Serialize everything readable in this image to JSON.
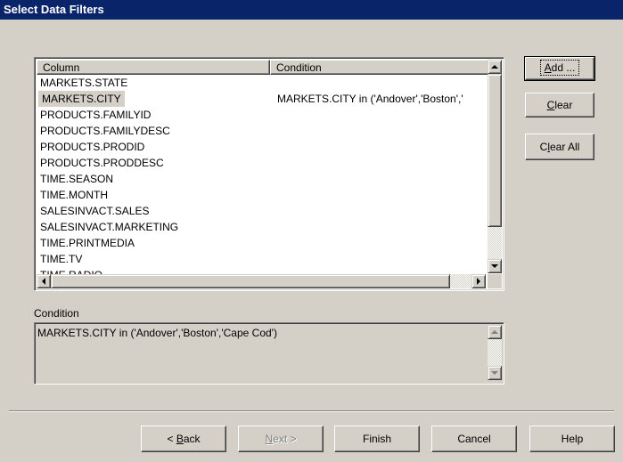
{
  "window": {
    "title": "Select Data Filters"
  },
  "list": {
    "columns": [
      "Column",
      "Condition"
    ],
    "rows": [
      {
        "column": "MARKETS.STATE",
        "condition": ""
      },
      {
        "column": "MARKETS.CITY",
        "condition": "MARKETS.CITY in ('Andover','Boston','",
        "selected": true
      },
      {
        "column": "PRODUCTS.FAMILYID",
        "condition": ""
      },
      {
        "column": "PRODUCTS.FAMILYDESC",
        "condition": ""
      },
      {
        "column": "PRODUCTS.PRODID",
        "condition": ""
      },
      {
        "column": "PRODUCTS.PRODDESC",
        "condition": ""
      },
      {
        "column": "TIME.SEASON",
        "condition": ""
      },
      {
        "column": "TIME.MONTH",
        "condition": ""
      },
      {
        "column": "SALESINVACT.SALES",
        "condition": ""
      },
      {
        "column": "SALESINVACT.MARKETING",
        "condition": ""
      },
      {
        "column": "TIME.PRINTMEDIA",
        "condition": ""
      },
      {
        "column": "TIME.TV",
        "condition": ""
      },
      {
        "column": "TIME.RADIO",
        "condition": ""
      }
    ]
  },
  "side_buttons": {
    "add_pre": "",
    "add_u": "A",
    "add_post": "dd ...",
    "clear_u": "C",
    "clear_post": "lear",
    "clearall_pre": "C",
    "clearall_u": "l",
    "clearall_post": "ear All"
  },
  "condition": {
    "label": "Condition",
    "value": "MARKETS.CITY in ('Andover','Boston','Cape Cod')"
  },
  "footer": {
    "back_pre": "< ",
    "back_u": "B",
    "back_post": "ack",
    "next_u": "N",
    "next_post": "ext >",
    "finish": "Finish",
    "cancel": "Cancel",
    "help": "Help"
  }
}
